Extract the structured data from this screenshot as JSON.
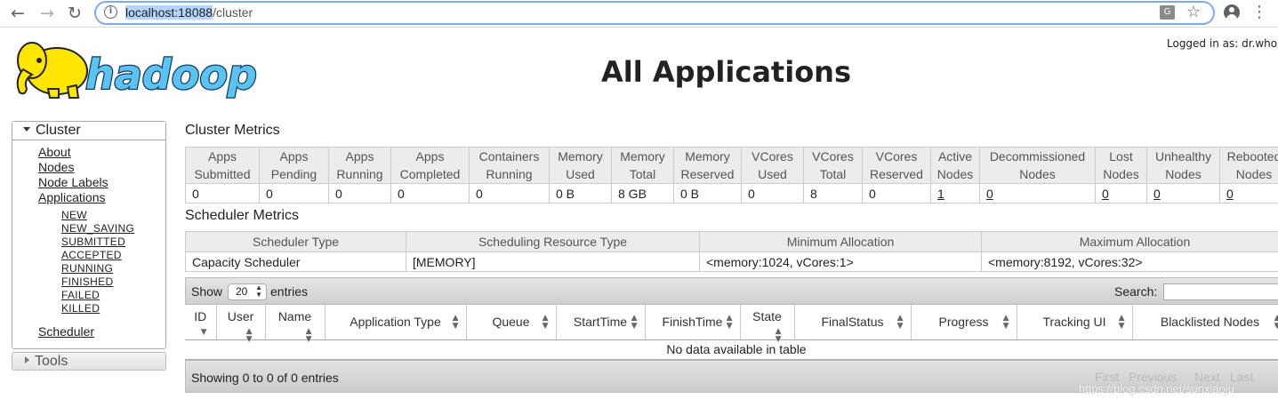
{
  "browser": {
    "url_host": "localhost:18088",
    "url_path": "/cluster",
    "info_icon": "i",
    "translate_icon": "G"
  },
  "header": {
    "logo": "hadoop",
    "title": "All Applications",
    "logged_in": "Logged in as: dr.who"
  },
  "sidebar": {
    "cluster_label": "Cluster",
    "links": [
      "About",
      "Nodes",
      "Node Labels",
      "Applications"
    ],
    "app_states": [
      "NEW",
      "NEW_SAVING",
      "SUBMITTED",
      "ACCEPTED",
      "RUNNING",
      "FINISHED",
      "FAILED",
      "KILLED"
    ],
    "scheduler": "Scheduler",
    "tools_label": "Tools"
  },
  "cluster_metrics": {
    "title": "Cluster Metrics",
    "headers": [
      [
        "Apps",
        "Submitted"
      ],
      [
        "Apps",
        "Pending"
      ],
      [
        "Apps",
        "Running"
      ],
      [
        "Apps",
        "Completed"
      ],
      [
        "Containers",
        "Running"
      ],
      [
        "Memory",
        "Used"
      ],
      [
        "Memory",
        "Total"
      ],
      [
        "Memory",
        "Reserved"
      ],
      [
        "VCores",
        "Used"
      ],
      [
        "VCores",
        "Total"
      ],
      [
        "VCores",
        "Reserved"
      ],
      [
        "Active",
        "Nodes"
      ],
      [
        "Decommissioned",
        "Nodes"
      ],
      [
        "Lost",
        "Nodes"
      ],
      [
        "Unhealthy",
        "Nodes"
      ],
      [
        "Rebooted",
        "Nodes"
      ]
    ],
    "values": [
      "0",
      "0",
      "0",
      "0",
      "0",
      "0 B",
      "8 GB",
      "0 B",
      "0",
      "8",
      "0",
      "1",
      "0",
      "0",
      "0",
      "0"
    ]
  },
  "scheduler_metrics": {
    "title": "Scheduler Metrics",
    "headers": [
      "Scheduler Type",
      "Scheduling Resource Type",
      "Minimum Allocation",
      "Maximum Allocation"
    ],
    "values": [
      "Capacity Scheduler",
      "[MEMORY]",
      "<memory:1024, vCores:1>",
      "<memory:8192, vCores:32>"
    ]
  },
  "apps_table": {
    "show_label": "Show",
    "page_length": "20",
    "entries_label": "entries",
    "search_label": "Search:",
    "columns": [
      "ID",
      "User",
      "Name",
      "Application Type",
      "Queue",
      "StartTime",
      "FinishTime",
      "State",
      "FinalStatus",
      "Progress",
      "Tracking UI",
      "Blacklisted Nodes"
    ],
    "empty_message": "No data available in table",
    "info": "Showing 0 to 0 of 0 entries",
    "pagination": [
      "First",
      "Previous",
      "Next",
      "Last"
    ]
  },
  "watermark": "https://blog.csdn.net/sunxiaoju"
}
